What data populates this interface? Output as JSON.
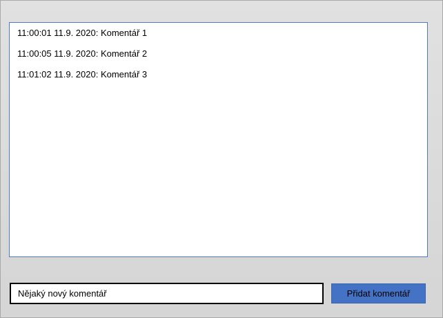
{
  "comments": [
    {
      "text": "11:00:01 11.9. 2020: Komentář 1"
    },
    {
      "text": "11:00:05 11.9. 2020: Komentář 2"
    },
    {
      "text": "11:01:02 11.9. 2020: Komentář 3"
    }
  ],
  "form": {
    "input_value": "Nějaký nový komentář",
    "submit_label": "Přidat komentář"
  },
  "colors": {
    "accent": "#4472c4",
    "list_border": "#4a78d1",
    "window_background": "#dcdcdc"
  }
}
